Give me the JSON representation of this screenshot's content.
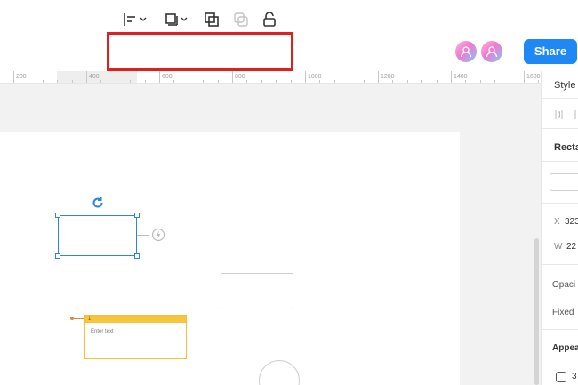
{
  "toolbar": {
    "tools": [
      {
        "name": "align-left-icon",
        "has_dropdown": true
      },
      {
        "name": "arrange-icon",
        "has_dropdown": true
      },
      {
        "name": "group-icon",
        "has_dropdown": false
      },
      {
        "name": "ungroup-icon",
        "has_dropdown": false,
        "disabled": true
      },
      {
        "name": "unlock-icon",
        "has_dropdown": false
      }
    ],
    "highlight_color": "#e0201f"
  },
  "collaborators": [
    "avatar-1",
    "avatar-2"
  ],
  "share_label": "Share",
  "accent_color": "#1e88f5",
  "ruler": {
    "labels": [
      "200",
      "400",
      "600",
      "800",
      "1000",
      "1200",
      "1400",
      "1600"
    ]
  },
  "canvas": {
    "sticky_note": {
      "header": "1",
      "placeholder": "Enter text"
    }
  },
  "panel": {
    "tab_style": "Style",
    "section_shape": "Recta",
    "x_label": "X",
    "x_value": "323",
    "w_label": "W",
    "w_value": "22",
    "opacity_label": "Opaci",
    "fixed_label": "Fixed",
    "appearance_label": "Appea",
    "checkbox_label": "3"
  }
}
